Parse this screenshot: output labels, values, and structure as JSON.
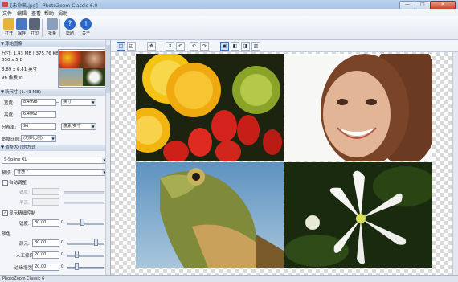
{
  "window": {
    "title": "[未命名.jpg] - PhotoZoom Classic 6.0",
    "min_label": "—",
    "max_label": "□",
    "close_label": "✕"
  },
  "menu": [
    "文件",
    "编辑",
    "查看",
    "帮助",
    "捐助"
  ],
  "toolbar": [
    {
      "label": "打开",
      "icon": "folder-open-icon",
      "color": "#e4b43c"
    },
    {
      "label": "保存",
      "icon": "save-icon",
      "color": "#4a79c4"
    },
    {
      "label": "打印",
      "icon": "print-icon",
      "color": "#5a6677"
    },
    {
      "label": "批量",
      "icon": "batch-icon",
      "color": "#6c8fb8"
    },
    {
      "label": "帮助",
      "icon": "help-icon",
      "color": "#2a67c9"
    },
    {
      "label": "关于",
      "icon": "info-icon",
      "color": "#2a67c9"
    }
  ],
  "panel": {
    "source_title": "源始图像",
    "source_size": "尺寸: 1.43 MB | 375.76 KB",
    "source_dims": "850 x 5 B",
    "source_inch": "8.89 x 6.41 英寸",
    "source_dpi": "96 像素/in",
    "new_size_title": "新尺寸 (1.43 MB)",
    "width_label": "宽度:",
    "width_value": "8.4998",
    "height_label": "高度:",
    "height_value": "6.4062",
    "unit": "英寸",
    "res_label": "分辨率:",
    "res_value": "96",
    "res_unit": "像素/英寸",
    "fit_label": "宽度比例:",
    "fit_value": "(巧妙比例)",
    "method_title": "调整大小的方式",
    "method_value": "S-Spline XL",
    "preset_label": "预设:",
    "preset_value": "普通 *",
    "auto_adjust_label": "自动调整",
    "strength1_label": "锐度:",
    "noise_label": "平滑:",
    "show_detail_label": "显示精细控制",
    "sharpness_label": "锐度:",
    "sharpness_value": "80.00",
    "sharpness_min": "0",
    "section2_label": "颜色",
    "c1_label": "颜元:",
    "c1_value": "80.00",
    "c1_min": "0",
    "c2_label": "人工修饰:",
    "c2_value": "20.00",
    "c2_min": "0",
    "c3_label": "边缘增强:",
    "c3_value": "20.00",
    "c3_min": "0"
  },
  "view_tools": [
    "□",
    "◰",
    "✥",
    "⇕",
    "↶",
    "↷",
    "▣",
    "◧",
    "◨",
    "▥"
  ],
  "status": "PhotoZoom Classic 6"
}
